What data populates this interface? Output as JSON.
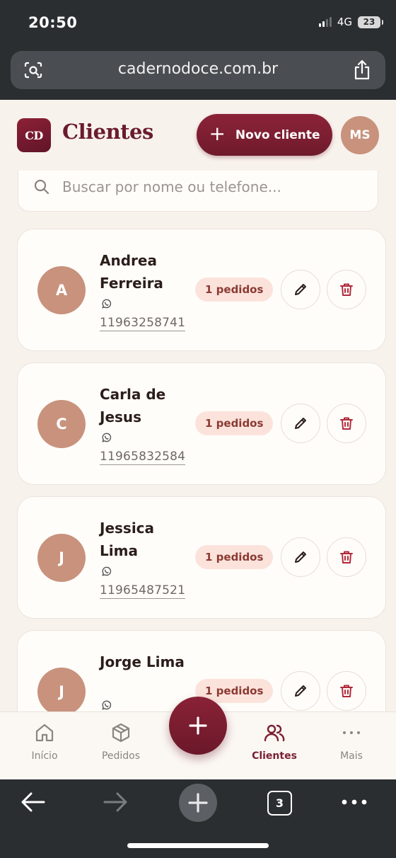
{
  "status_bar": {
    "time": "20:50",
    "network": "4G",
    "battery": "23"
  },
  "browser": {
    "url": "cadernodoce.com.br",
    "tab_count": "3"
  },
  "header": {
    "logo_text": "CD",
    "title": "Clientes",
    "new_button_label": "Novo cliente",
    "user_initials": "MS"
  },
  "search": {
    "placeholder": "Buscar por nome ou telefone..."
  },
  "clients": [
    {
      "initial": "A",
      "name": "Andrea Ferreira",
      "phone": "11963258741",
      "orders": "1 pedidos"
    },
    {
      "initial": "C",
      "name": "Carla de Jesus",
      "phone": "11965832584",
      "orders": "1 pedidos"
    },
    {
      "initial": "J",
      "name": "Jessica Lima",
      "phone": "11965487521",
      "orders": "1 pedidos"
    },
    {
      "initial": "J",
      "name": "Jorge Lima",
      "phone": "",
      "orders": "1 pedidos"
    }
  ],
  "bottom_nav": {
    "items": [
      {
        "label": "Início",
        "icon": "home-icon"
      },
      {
        "label": "Pedidos",
        "icon": "box-icon"
      },
      {
        "label": "Clientes",
        "icon": "users-icon",
        "active": true
      },
      {
        "label": "Mais",
        "icon": "more-icon"
      }
    ]
  },
  "colors": {
    "brand": "#7a1f32",
    "avatar": "#c8927d",
    "badge_bg": "#fbe3dc",
    "background": "#f8f2ed"
  }
}
